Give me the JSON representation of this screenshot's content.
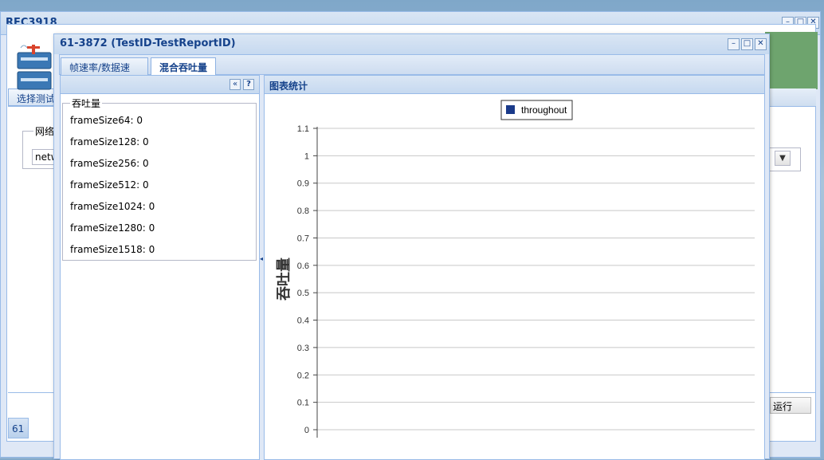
{
  "outer_window": {
    "title": "RFC3918",
    "tab_label": "选择测试",
    "field_legend": "网络",
    "field_value": "netw",
    "run_button": "运行",
    "page_tab": "61"
  },
  "inner_window": {
    "title": "61-3872 (TestID-TestReportID)",
    "tabs": [
      {
        "label": "帧速率/数据速率"
      },
      {
        "label": "混合吞吐量"
      }
    ],
    "left_panel": {
      "fieldset_legend": "吞吐量",
      "items": [
        {
          "label": "frameSize64: 0"
        },
        {
          "label": "frameSize128: 0"
        },
        {
          "label": "frameSize256: 0"
        },
        {
          "label": "frameSize512: 0"
        },
        {
          "label": "frameSize1024: 0"
        },
        {
          "label": "frameSize1280: 0"
        },
        {
          "label": "frameSize1518: 0"
        }
      ]
    },
    "right_panel": {
      "title": "图表统计"
    }
  },
  "icons": {
    "collapse": "double-chevron-left-icon",
    "help": "help-icon",
    "minimize": "minimize-icon",
    "maximize": "maximize-icon",
    "close": "close-icon",
    "dropdown": "chevron-down-icon"
  },
  "chart_data": {
    "type": "bar",
    "title": "",
    "ylabel": "吞吐量",
    "xlabel": "",
    "ylim": [
      0,
      1.1
    ],
    "yticks": [
      "0",
      "0.1",
      "0.2",
      "0.3",
      "0.4",
      "0.5",
      "0.6",
      "0.7",
      "0.8",
      "0.9",
      "1",
      "1.1"
    ],
    "grid": true,
    "legend_position": "top-center",
    "series": [
      {
        "name": "throughout",
        "color": "#1a3a8a",
        "values": []
      }
    ]
  }
}
